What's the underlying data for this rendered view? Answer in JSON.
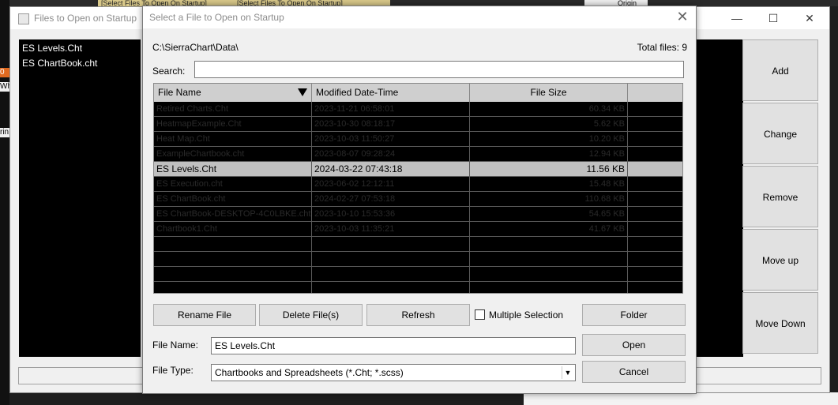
{
  "background": {
    "tab_text_1": "[Select Files To Open On Startup]",
    "tab_text_2": "[Select Files To Open On Startup]",
    "origin_label": "Origin",
    "left_chip_1": "0",
    "left_chip_2": "Wh",
    "left_chip_3": "rin"
  },
  "parent_window": {
    "title": "Files to Open on Startup",
    "files": [
      "ES Levels.Cht",
      "ES ChartBook.cht"
    ],
    "buttons": [
      "Add",
      "Change",
      "Remove",
      "Move up",
      "Move Down"
    ],
    "controls": {
      "minimize": "—",
      "maximize": "☐",
      "close": "✕"
    }
  },
  "dialog": {
    "title": "Select a File to Open on Startup",
    "close_glyph": "✕",
    "path": "C:\\SierraChart\\Data\\",
    "total_files": "Total files: 9",
    "search_label": "Search:",
    "search_value": "",
    "columns": [
      "File Name",
      "Modified Date-Time",
      "File Size"
    ],
    "sort_icon": "sort-descending-icon",
    "rows": [
      {
        "name": "Retired Charts.Cht",
        "modified": "2023-11-21  06:58:01",
        "size": "60.34 KB",
        "selected": false
      },
      {
        "name": "HeatmapExample.Cht",
        "modified": "2023-10-30  08:18:17",
        "size": "5.62 KB",
        "selected": false
      },
      {
        "name": "Heat Map.Cht",
        "modified": "2023-10-03  11:50:27",
        "size": "10.20 KB",
        "selected": false
      },
      {
        "name": "ExampleChartbook.cht",
        "modified": "2023-08-07  09:28:24",
        "size": "12.94 KB",
        "selected": false
      },
      {
        "name": "ES Levels.Cht",
        "modified": "2024-03-22  07:43:18",
        "size": "11.56 KB",
        "selected": true
      },
      {
        "name": "ES Execution.cht",
        "modified": "2023-06-02  12:12:11",
        "size": "15.48 KB",
        "selected": false
      },
      {
        "name": "ES ChartBook.cht",
        "modified": "2024-02-27  07:53:18",
        "size": "110.68 KB",
        "selected": false
      },
      {
        "name": "ES ChartBook-DESKTOP-4C0LBKE.cht",
        "modified": "2023-10-10  15:53:36",
        "size": "54.65 KB",
        "selected": false
      },
      {
        "name": "Chartbook1.Cht",
        "modified": "2023-10-03  11:35:21",
        "size": "41.67 KB",
        "selected": false
      }
    ],
    "buttons": {
      "rename": "Rename File",
      "delete": "Delete File(s)",
      "refresh": "Refresh",
      "multiple_selection": "Multiple Selection",
      "folder": "Folder",
      "open": "Open",
      "cancel": "Cancel"
    },
    "multiple_selection_checked": false,
    "file_name_label": "File Name:",
    "file_name_value": "ES Levels.Cht",
    "file_type_label": "File Type:",
    "file_type_value": "Chartbooks and Spreadsheets (*.Cht; *.scss)",
    "file_type_arrow": "▼"
  }
}
